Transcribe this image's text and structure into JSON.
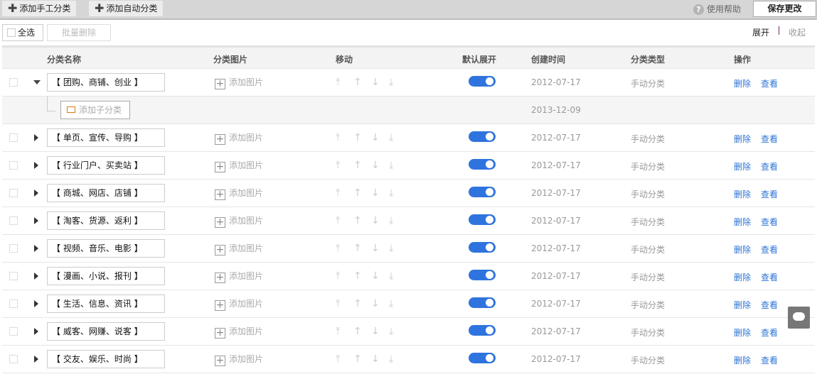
{
  "topbar": {
    "add_manual": "添加手工分类",
    "add_auto": "添加自动分类",
    "help": "使用帮助",
    "save": "保存更改"
  },
  "toolbar": {
    "select_all": "全选",
    "batch_delete": "批量删除",
    "expand": "展开",
    "collapse": "收起"
  },
  "columns": {
    "name": "分类名称",
    "image": "分类图片",
    "move": "移动",
    "default_expand": "默认展开",
    "created": "创建时间",
    "type": "分类类型",
    "ops": "操作"
  },
  "labels": {
    "add_image": "添加图片",
    "add_sub": "添加子分类",
    "delete": "删除",
    "view": "查看",
    "sub_date": "2013-12-09"
  },
  "rows": [
    {
      "name": "【 团购、商铺、创业 】",
      "date": "2012-07-17",
      "type": "手动分类",
      "expanded": true,
      "default_expand": true
    },
    {
      "name": "【 单页、宣传、导购 】",
      "date": "2012-07-17",
      "type": "手动分类",
      "expanded": false,
      "default_expand": true
    },
    {
      "name": "【 行业门户、买卖站 】",
      "date": "2012-07-17",
      "type": "手动分类",
      "expanded": false,
      "default_expand": true
    },
    {
      "name": "【 商城、网店、店铺 】",
      "date": "2012-07-17",
      "type": "手动分类",
      "expanded": false,
      "default_expand": true
    },
    {
      "name": "【 淘客、货源、返利 】",
      "date": "2012-07-17",
      "type": "手动分类",
      "expanded": false,
      "default_expand": true
    },
    {
      "name": "【 视频、音乐、电影 】",
      "date": "2012-07-17",
      "type": "手动分类",
      "expanded": false,
      "default_expand": true
    },
    {
      "name": "【 漫画、小说、报刊 】",
      "date": "2012-07-17",
      "type": "手动分类",
      "expanded": false,
      "default_expand": true
    },
    {
      "name": "【 生活、信息、资讯 】",
      "date": "2012-07-17",
      "type": "手动分类",
      "expanded": false,
      "default_expand": true
    },
    {
      "name": "【 威客、网赚、说客 】",
      "date": "2012-07-17",
      "type": "手动分类",
      "expanded": false,
      "default_expand": true
    },
    {
      "name": "【 交友、娱乐、时尚 】",
      "date": "2012-07-17",
      "type": "手动分类",
      "expanded": false,
      "default_expand": true
    }
  ]
}
